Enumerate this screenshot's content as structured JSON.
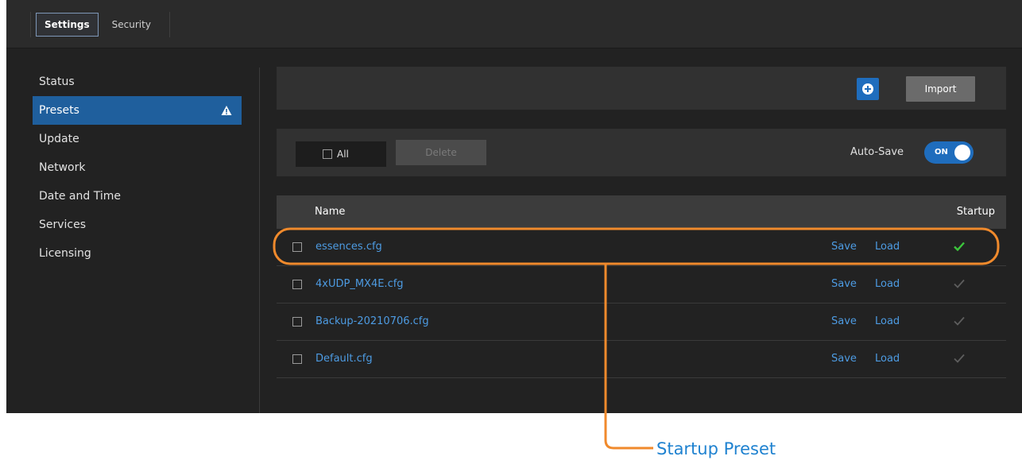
{
  "topbar": {
    "tabs": [
      {
        "label": "Settings",
        "active": true
      },
      {
        "label": "Security",
        "active": false
      }
    ]
  },
  "sidebar": {
    "items": [
      {
        "label": "Status"
      },
      {
        "label": "Presets",
        "active": true,
        "icon": "warning-icon"
      },
      {
        "label": "Update"
      },
      {
        "label": "Network"
      },
      {
        "label": "Date and Time"
      },
      {
        "label": "Services"
      },
      {
        "label": "Licensing"
      }
    ]
  },
  "toolbar": {
    "add_icon": "plus-circle-icon",
    "import_label": "Import"
  },
  "actions": {
    "all_label": "All",
    "delete_label": "Delete",
    "autosave_label": "Auto-Save",
    "autosave_state": "ON"
  },
  "table": {
    "headers": {
      "name": "Name",
      "startup": "Startup"
    },
    "rows": [
      {
        "name": "essences.cfg",
        "save": "Save",
        "load": "Load",
        "startup": true
      },
      {
        "name": "4xUDP_MX4E.cfg",
        "save": "Save",
        "load": "Load",
        "startup": false
      },
      {
        "name": "Backup-20210706.cfg",
        "save": "Save",
        "load": "Load",
        "startup": false
      },
      {
        "name": "Default.cfg",
        "save": "Save",
        "load": "Load",
        "startup": false
      }
    ]
  },
  "callout": {
    "label": "Startup Preset"
  },
  "colors": {
    "accent": "#1f6dbd",
    "link": "#4d9be2",
    "callout": "#f08a2c",
    "callout_text": "#1f82d0",
    "startup_active": "#3cc53c",
    "startup_inactive": "#5e5e5e"
  }
}
